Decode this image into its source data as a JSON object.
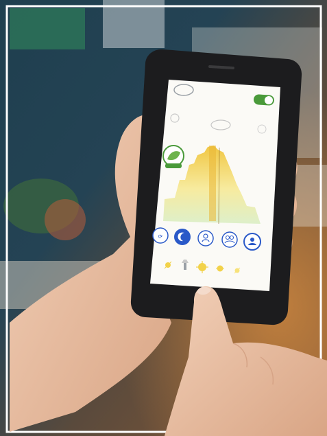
{
  "scene": {
    "description_name": "photo-hand-holding-phone",
    "phone_app": {
      "top_bar": {
        "left_icon": "cloud-icon",
        "toggle_state": "on",
        "toggle_color": "#4a9a3a"
      },
      "status_icons": [
        "sun-outline-icon",
        "cloud-outline-icon"
      ],
      "badge_icon": "leaf-badge-icon",
      "bar_chart_colors": [
        "#f2d24a",
        "#f7ec9a",
        "#d9edc0"
      ],
      "mode_buttons": [
        {
          "icon": "auto-icon",
          "active": false
        },
        {
          "icon": "moon-icon",
          "active": true
        },
        {
          "icon": "person-icon",
          "active": false
        },
        {
          "icon": "people-icon",
          "active": false
        },
        {
          "icon": "person-circle-icon",
          "active": false
        }
      ],
      "bottom_icons": [
        "sun-low-icon",
        "lamp-icon",
        "sun-bright-icon",
        "sun-mid-icon",
        "sun-dim-icon"
      ]
    },
    "colors": {
      "accent_blue": "#2a59c8",
      "screen_bg": "#fbfaf6",
      "phone_body": "#1c1c1e",
      "skin": "#e9bfa3"
    }
  }
}
